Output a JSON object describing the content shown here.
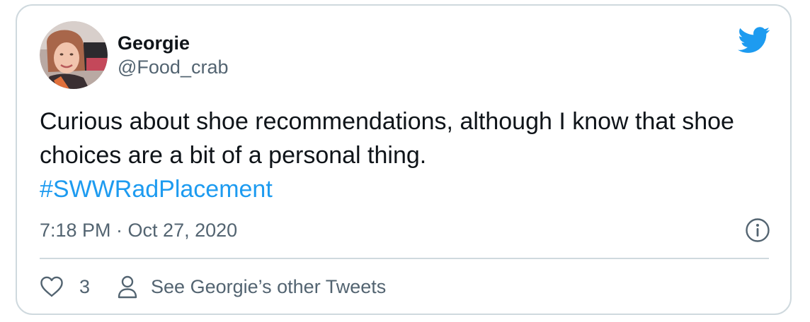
{
  "tweet": {
    "author": {
      "display_name": "Georgie",
      "handle": "@Food_crab"
    },
    "text": "Curious about shoe recommendations, although I know that shoe choices are a bit of a personal thing.",
    "hashtag": "#SWWRadPlacement",
    "timestamp": "7:18 PM · Oct 27, 2020",
    "like_count": "3",
    "profile_link_label": "See Georgie’s other Tweets"
  },
  "icons": {
    "brand": "twitter-bird-icon",
    "info": "info-icon",
    "like": "heart-icon",
    "profile": "person-icon"
  },
  "colors": {
    "brand_blue": "#1d9bf0",
    "text_primary": "#0f1419",
    "text_secondary": "#536471",
    "border": "#cfd9de"
  }
}
